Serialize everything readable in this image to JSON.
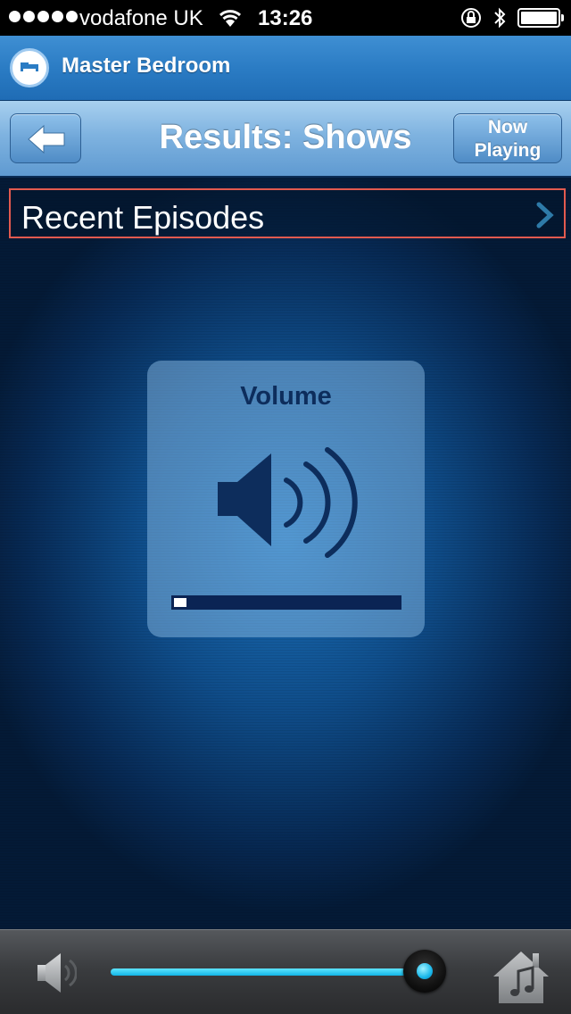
{
  "status_bar": {
    "carrier": "vodafone UK",
    "time": "13:26",
    "icons": [
      "signal-dots-icon",
      "wifi-icon",
      "rotation-lock-icon",
      "bluetooth-icon",
      "battery-icon"
    ]
  },
  "room": {
    "title": "Master Bedroom",
    "icon": "bed-icon"
  },
  "nav": {
    "title": "Results: Shows",
    "back_icon": "back-arrow-icon",
    "now_playing_line1": "Now",
    "now_playing_line2": "Playing"
  },
  "list": {
    "items": [
      {
        "label": "Recent Episodes",
        "icon": "chevron-right-icon"
      }
    ]
  },
  "volume_hud": {
    "title": "Volume",
    "icon": "speaker-icon",
    "level": 0.05
  },
  "bottom_bar": {
    "speaker_icon": "speaker-icon",
    "volume_level": 0.95,
    "home_icon": "home-music-icon"
  },
  "colors": {
    "accent": "#2b7cc4",
    "highlight_border": "#e25a4f",
    "slider": "#12b6e6",
    "hud_text": "#0d2d5c"
  }
}
